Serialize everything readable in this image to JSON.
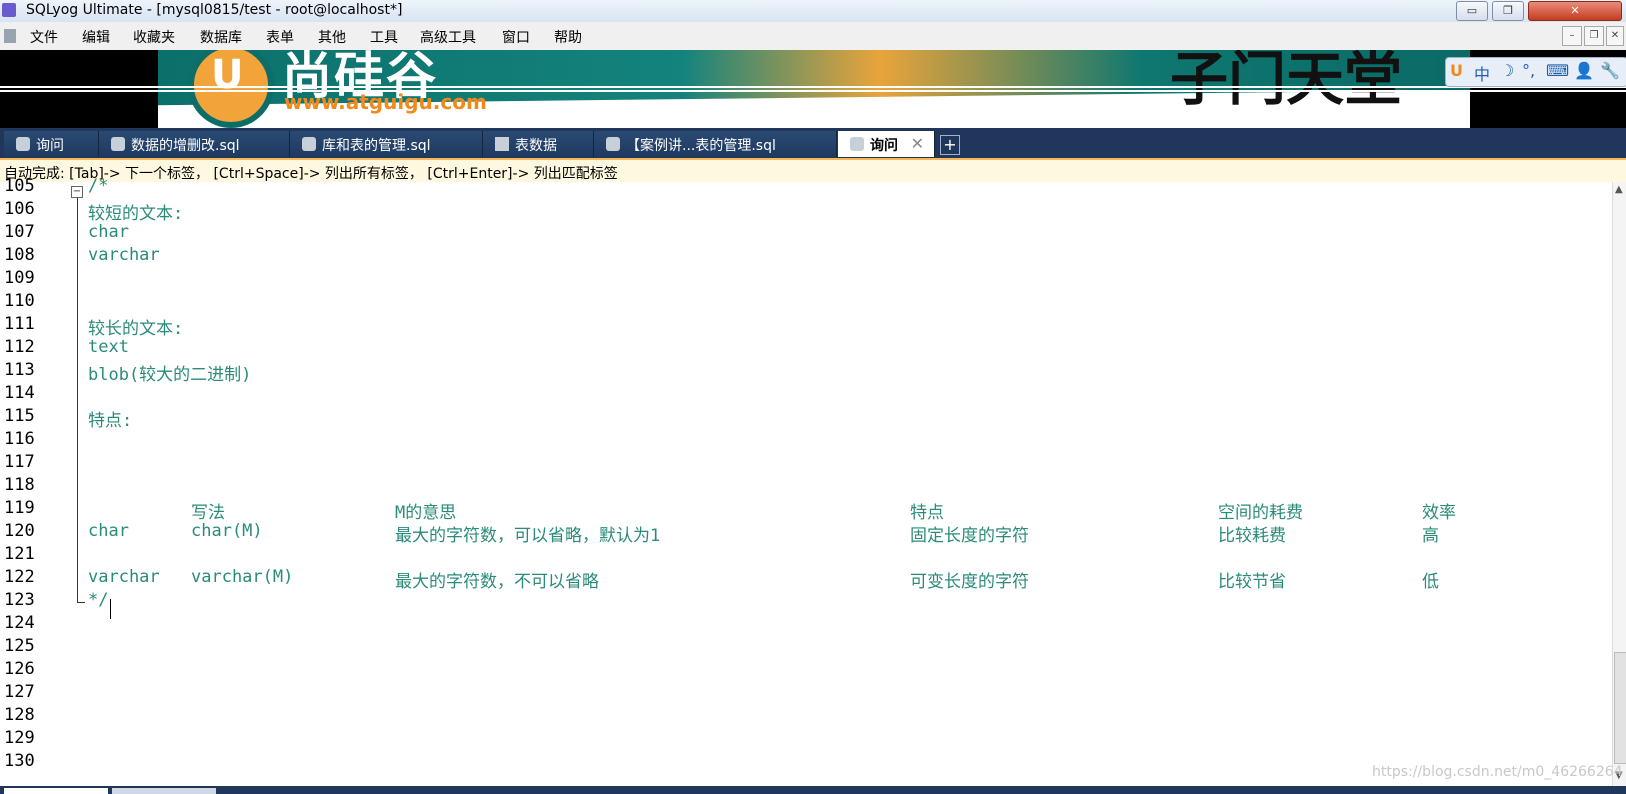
{
  "window": {
    "title": "SQLyog Ultimate - [mysql0815/test - root@localhost*]",
    "minimize": "▭",
    "restore": "❐",
    "close": "✕"
  },
  "menu": {
    "items": [
      "文件",
      "编辑",
      "收藏夹",
      "数据库",
      "表单",
      "其他",
      "工具",
      "高级工具",
      "窗口",
      "帮助"
    ],
    "mdi_min": "–",
    "mdi_restore": "❐",
    "mdi_close": "✕"
  },
  "banner": {
    "logo_u": "U",
    "logo_text": "尚硅谷",
    "url": "www.atguigu.com",
    "slogan": "子门天堂"
  },
  "ime": {
    "items": [
      "中",
      "☽",
      "°,",
      "⌨",
      "👤",
      "🔧"
    ]
  },
  "tabs": [
    {
      "label": "询问",
      "active": false
    },
    {
      "label": "数据的增删改.sql",
      "active": false
    },
    {
      "label": "库和表的管理.sql",
      "active": false
    },
    {
      "label": "表数据",
      "active": false
    },
    {
      "label": "【案例讲...表的管理.sql",
      "active": false
    },
    {
      "label": "询问",
      "active": true
    }
  ],
  "tab_close": "✕",
  "tab_add": "+",
  "hint": "自动完成:  [Tab]-> 下一个标签，  [Ctrl+Space]-> 列出所有标签，  [Ctrl+Enter]-> 列出匹配标签",
  "editor": {
    "fold_marker": "−",
    "line_numbers": [
      "105",
      "106",
      "107",
      "108",
      "109",
      "110",
      "111",
      "112",
      "113",
      "114",
      "115",
      "116",
      "117",
      "118",
      "119",
      "120",
      "121",
      "122",
      "123",
      "124",
      "125",
      "126",
      "127",
      "128",
      "129",
      "130"
    ],
    "lines": [
      "/*",
      "较短的文本:",
      "char",
      "varchar",
      "",
      "",
      "较长的文本:",
      "text",
      "blob(较大的二进制)",
      "",
      "特点:",
      "",
      "",
      "",
      "",
      "",
      "",
      "",
      "*/",
      "",
      "",
      "",
      "",
      "",
      "",
      ""
    ],
    "table": {
      "header": [
        "写法",
        "M的意思",
        "特点",
        "空间的耗费",
        "效率"
      ],
      "rows": [
        [
          "char",
          "char(M)",
          "最大的字符数，可以省略，默认为1",
          "固定长度的字符",
          "比较耗费",
          "高"
        ],
        [
          "varchar",
          "varchar(M)",
          "最大的字符数，不可以省略",
          "可变长度的字符",
          "比较节省",
          "低"
        ]
      ]
    }
  },
  "scroll": {
    "up": "▲",
    "down": "▼"
  },
  "watermark": "https://blog.csdn.net/m0_46266264"
}
